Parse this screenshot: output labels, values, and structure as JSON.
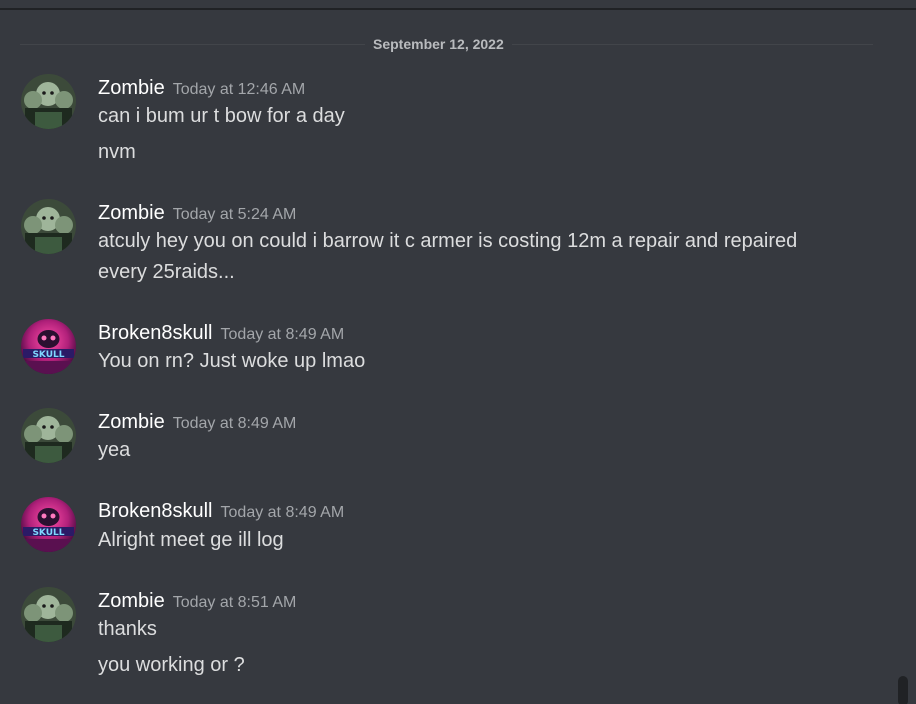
{
  "date_divider": "September 12, 2022",
  "messages": [
    {
      "author": "Zombie",
      "timestamp": "Today at 12:46 AM",
      "avatar": "zombie-avatar",
      "lines": [
        "can i bum ur t bow for a day",
        "nvm"
      ]
    },
    {
      "author": "Zombie",
      "timestamp": "Today at 5:24 AM",
      "avatar": "zombie-avatar",
      "lines": [
        "atculy hey you on could i barrow it c armer is costing 12m a repair and repaired",
        "every 25raids..."
      ]
    },
    {
      "author": "Broken8skull",
      "timestamp": "Today at 8:49 AM",
      "avatar": "skull-avatar",
      "lines": [
        "You on rn? Just woke up lmao"
      ]
    },
    {
      "author": "Zombie",
      "timestamp": "Today at 8:49 AM",
      "avatar": "zombie-avatar",
      "lines": [
        "yea"
      ]
    },
    {
      "author": "Broken8skull",
      "timestamp": "Today at 8:49 AM",
      "avatar": "skull-avatar",
      "lines": [
        "Alright meet ge ill log"
      ]
    },
    {
      "author": "Zombie",
      "timestamp": "Today at 8:51 AM",
      "avatar": "zombie-avatar",
      "lines": [
        "thanks",
        "you working or ?"
      ]
    }
  ],
  "avatar_skull_text": "SKULL",
  "colors": {
    "background": "#36393f",
    "author": "#ffffff",
    "message_text": "#dcddde",
    "timestamp": "#a3a6aa",
    "divider": "#42454a"
  }
}
